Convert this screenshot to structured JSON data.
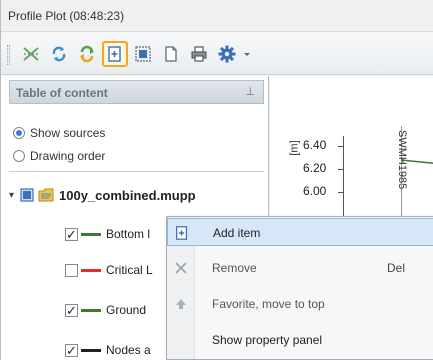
{
  "window": {
    "title": "Profile Plot (08:48:23)"
  },
  "toolbar": {
    "buttons": [
      {
        "icon": "profile-icon"
      },
      {
        "icon": "refresh-icon"
      },
      {
        "icon": "sync-icon"
      },
      {
        "icon": "add-item-icon",
        "active": true
      },
      {
        "icon": "select-icon"
      },
      {
        "icon": "copy-icon"
      },
      {
        "icon": "print-icon"
      },
      {
        "icon": "settings-icon"
      },
      {
        "icon": "dropdown-icon"
      }
    ]
  },
  "sidebar": {
    "header_label": "Table of content",
    "pin_glyph": "⊥",
    "options": [
      {
        "label": "Show sources",
        "checked": true
      },
      {
        "label": "Drawing order",
        "checked": false
      }
    ],
    "root": {
      "label": "100y_combined.mupp"
    },
    "layers": [
      {
        "label": "Bottom l",
        "checked": true,
        "color": "#3d7a2a"
      },
      {
        "label": "Critical L",
        "checked": false,
        "color": "#e0312b"
      },
      {
        "label": "Ground",
        "checked": true,
        "color": "#3d7a2a"
      },
      {
        "label": "Nodes a",
        "checked": true,
        "color": "#222222"
      }
    ],
    "check_glyph": "✓"
  },
  "plot": {
    "unit_label": "[m]",
    "ticks": [
      "6.40",
      "6.20",
      "6.00"
    ],
    "station_label": "SWMH1985"
  },
  "context_menu": {
    "items": [
      {
        "label": "Add item",
        "shortcut": "",
        "icon": "add-item-icon",
        "state": "hover"
      },
      {
        "label": "Remove",
        "shortcut": "Del",
        "icon": "remove-icon",
        "state": "disabled"
      },
      {
        "label": "Favorite, move to top",
        "shortcut": "",
        "icon": "arrow-up-icon",
        "state": "disabled"
      },
      {
        "label": "Show property panel",
        "shortcut": "",
        "icon": "",
        "state": "normal"
      }
    ]
  },
  "colors": {
    "accent": "#3a7bd5",
    "active_border": "#f2a623",
    "hover_bg": "#d7e7f8"
  }
}
